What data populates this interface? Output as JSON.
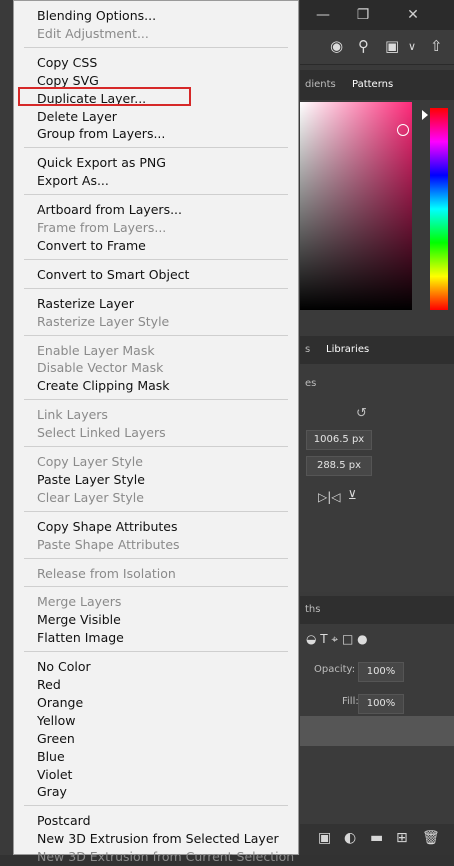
{
  "menu": {
    "groups": [
      [
        {
          "label": "Blending Options...",
          "disabled": false
        },
        {
          "label": "Edit Adjustment...",
          "disabled": true
        }
      ],
      [
        {
          "label": "Copy CSS",
          "disabled": false
        },
        {
          "label": "Copy SVG",
          "disabled": false
        },
        {
          "label": "Duplicate Layer...",
          "disabled": false,
          "highlighted": true
        },
        {
          "label": "Delete Layer",
          "disabled": false
        },
        {
          "label": "Group from Layers...",
          "disabled": false
        }
      ],
      [
        {
          "label": "Quick Export as PNG",
          "disabled": false
        },
        {
          "label": "Export As...",
          "disabled": false
        }
      ],
      [
        {
          "label": "Artboard from Layers...",
          "disabled": false
        },
        {
          "label": "Frame from Layers...",
          "disabled": true
        },
        {
          "label": "Convert to Frame",
          "disabled": false
        }
      ],
      [
        {
          "label": "Convert to Smart Object",
          "disabled": false
        }
      ],
      [
        {
          "label": "Rasterize Layer",
          "disabled": false
        },
        {
          "label": "Rasterize Layer Style",
          "disabled": true
        }
      ],
      [
        {
          "label": "Enable Layer Mask",
          "disabled": true
        },
        {
          "label": "Disable Vector Mask",
          "disabled": true
        },
        {
          "label": "Create Clipping Mask",
          "disabled": false
        }
      ],
      [
        {
          "label": "Link Layers",
          "disabled": true
        },
        {
          "label": "Select Linked Layers",
          "disabled": true
        }
      ],
      [
        {
          "label": "Copy Layer Style",
          "disabled": true
        },
        {
          "label": "Paste Layer Style",
          "disabled": false
        },
        {
          "label": "Clear Layer Style",
          "disabled": true
        }
      ],
      [
        {
          "label": "Copy Shape Attributes",
          "disabled": false
        },
        {
          "label": "Paste Shape Attributes",
          "disabled": true
        }
      ],
      [
        {
          "label": "Release from Isolation",
          "disabled": true
        }
      ],
      [
        {
          "label": "Merge Layers",
          "disabled": true
        },
        {
          "label": "Merge Visible",
          "disabled": false
        },
        {
          "label": "Flatten Image",
          "disabled": false
        }
      ],
      [
        {
          "label": "No Color",
          "disabled": false
        },
        {
          "label": "Red",
          "disabled": false
        },
        {
          "label": "Orange",
          "disabled": false
        },
        {
          "label": "Yellow",
          "disabled": false
        },
        {
          "label": "Green",
          "disabled": false
        },
        {
          "label": "Blue",
          "disabled": false
        },
        {
          "label": "Violet",
          "disabled": false
        },
        {
          "label": "Gray",
          "disabled": false
        }
      ],
      [
        {
          "label": "Postcard",
          "disabled": false
        },
        {
          "label": "New 3D Extrusion from Selected Layer",
          "disabled": false
        },
        {
          "label": "New 3D Extrusion from Current Selection",
          "disabled": true
        }
      ]
    ],
    "highlight_color": "#d62828"
  },
  "background": {
    "panel_tabs": [
      "dients",
      "Patterns"
    ],
    "section_tabs": [
      "s",
      "Libraries"
    ],
    "props_label": "es",
    "width_value": "1006.5 px",
    "height_value": "288.5 px",
    "layers_tab": "ths",
    "opacity_label": "Opacity:",
    "opacity_value": "100%",
    "fill_label": "Fill:",
    "fill_value": "100%",
    "icons": {
      "minimize": "minimize-icon",
      "restore": "restore-icon",
      "close": "close-icon",
      "search": "search-icon",
      "share": "share-icon"
    }
  }
}
